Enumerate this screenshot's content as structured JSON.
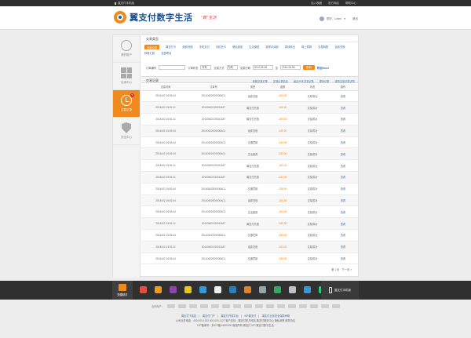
{
  "topbar": {
    "app_link": "翼支付手机版",
    "links": [
      "加入收藏",
      "官方网店",
      "帮助中心"
    ]
  },
  "header": {
    "logo": "翼支付数字生活",
    "slogan": "“数”生活",
    "user": "您好，Learn",
    "logout": "退出"
  },
  "sidebar": [
    {
      "label": "我的账户"
    },
    {
      "label": "应用中心"
    },
    {
      "label": "交易记录",
      "badge": "5"
    },
    {
      "label": "安全中心"
    }
  ],
  "section_title": "交易类型",
  "types": [
    "全部交易",
    "翼支付卡",
    "缴费充值",
    "手机支付",
    "手机充卡",
    "便民缴费",
    "生活缴费",
    "提现手续费",
    "零钱转出",
    "网上购物",
    "交易转账",
    "话费兑换",
    "转账汇款",
    "全部项目"
  ],
  "filters": {
    "order_label": "订单编号",
    "status_label": "订单状态",
    "status_value": "所有",
    "method_label": "交易方式",
    "method_value": "所有",
    "date_label": "交易日期",
    "start_date": "2014-05-08",
    "to": "至",
    "end_date": "2014-05-08",
    "query": "查询",
    "export": "导出Excel"
  },
  "records": {
    "title": "交易记录",
    "links": [
      "收款交易记录",
      "交易记录信息",
      "最近30天交易记录",
      "更多记录",
      "查看交易记录详情"
    ]
  },
  "table": {
    "headers": [
      "交易时间",
      "订单号",
      "类型",
      "金额",
      "状态",
      "操作"
    ],
    "rows": [
      [
        "2014/4/2  15:52:44",
        "20140402000000ACL",
        "话费充值",
        "-100.00",
        "交易成功",
        "查看"
      ],
      [
        "2014/4/2  15:51:11",
        "20140402C00011187",
        "翼支付充值",
        "-100.00",
        "交易成功",
        "查看"
      ],
      [
        "2014/4/2  15:51:11",
        "20140402C00011187",
        "翼支付充值",
        "-100.00",
        "交易成功",
        "查看"
      ],
      [
        "2014/4/2  15:52:44",
        "20140402000000ACL",
        "话费充值",
        "-100.00",
        "交易成功",
        "查看"
      ],
      [
        "2014/4/2  15:52:44",
        "20140402000000ACL",
        "交通罚款",
        "-230.00",
        "交易成功",
        "查看"
      ],
      [
        "2014/4/2  15:52:44",
        "20140402000000ACL",
        "生活缴费",
        "-100.00",
        "交易成功",
        "查看"
      ],
      [
        "2014/4/2  15:51:11",
        "20140402C00011187",
        "翼支付充值",
        "-100.00",
        "交易成功",
        "查看"
      ],
      [
        "2014/4/2  15:51:11",
        "20140402C00011187",
        "翼支付充值",
        "-100.00",
        "交易成功",
        "查看"
      ],
      [
        "2014/4/2  15:52:44",
        "20140402000000ACL",
        "交通罚款",
        "-230.00",
        "交易成功",
        "查看"
      ],
      [
        "2014/4/2  15:52:44",
        "20140402000000ACL",
        "话费充值",
        "-100.00",
        "交易成功",
        "查看"
      ],
      [
        "2014/4/2  15:52:44",
        "20140402000000ACL",
        "生活缴费",
        "-100.00",
        "交易成功",
        "查看"
      ],
      [
        "2014/4/2  15:51:11",
        "20140402C00011187",
        "翼支付充值",
        "-100.00",
        "交易成功",
        "查看"
      ],
      [
        "2014/4/2  15:52:44",
        "20140402000000ACL",
        "交通罚款",
        "-230.00",
        "交易成功",
        "查看"
      ],
      [
        "2014/4/2  15:51:11",
        "20140402C00011187",
        "话费充值",
        "-100.00",
        "交易成功",
        "查看"
      ],
      [
        "2014/4/2  15:52:44",
        "20140402000000ACL",
        "交通罚款",
        "-230.00",
        "交易成功",
        "查看"
      ]
    ]
  },
  "pager": {
    "page": "第 1 页",
    "next": "下一页 »"
  },
  "dock": {
    "left_label": "快捷助手",
    "right_label": "翼支付手机版",
    "icon_colors": [
      "#e74c3c",
      "#f39c12",
      "#8e44ad",
      "#f1c40f",
      "#3498db",
      "#ecf0f1",
      "#2980b9",
      "#e67e22",
      "#95a5a6",
      "#27ae60",
      "#bdc3c7",
      "#3498db",
      "#2ecc71"
    ]
  },
  "partners_label": "合作商户：",
  "footer": {
    "line1": [
      "翼支付下载站",
      "翼支付门户",
      "翼支付开放平台",
      "ISP翼支付",
      "翼支付业务安全保障声明"
    ],
    "line2": "公司业务电话：400-000-1022  400-000-1127  客户支持：翼支付官方网站  翼支付服务中心  隐私政策  服务协议",
    "line3": "ICP备案号：京ICP备14000000  版权所有  翼支付  ICP  翼支付数字生活"
  }
}
